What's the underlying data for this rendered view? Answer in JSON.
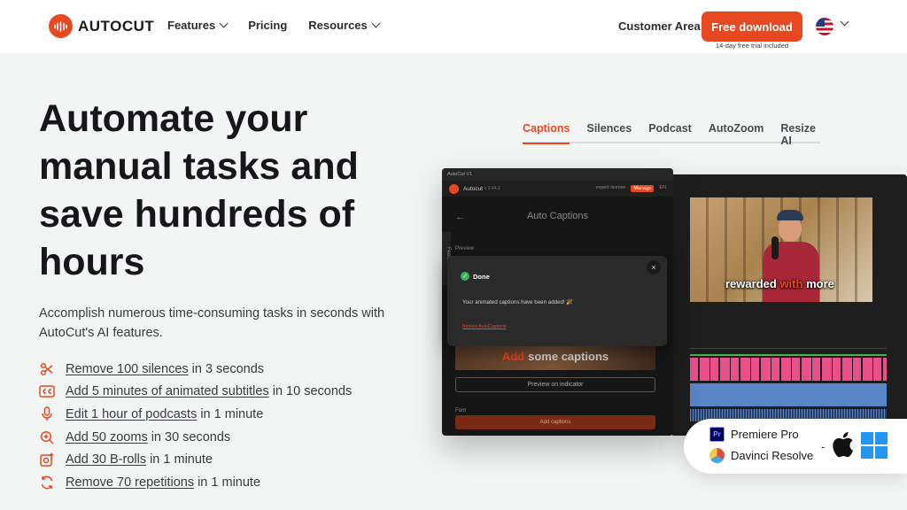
{
  "header": {
    "brand": "AUTOCUT",
    "nav": [
      {
        "label": "Features",
        "has_dropdown": true
      },
      {
        "label": "Pricing",
        "has_dropdown": false
      },
      {
        "label": "Resources",
        "has_dropdown": true
      }
    ],
    "customer_area": "Customer Area",
    "cta_label": "Free download",
    "cta_note": "14-day free trial included",
    "language_icon": "us-flag-icon"
  },
  "hero": {
    "title": "Automate your manual tasks and save hundreds of hours",
    "subtitle": "Accomplish numerous time-consuming tasks in seconds with AutoCut's AI features.",
    "features": [
      {
        "icon": "scissors-icon",
        "link": "Remove 100 silences",
        "rest": "in 3 seconds"
      },
      {
        "icon": "cc-icon",
        "link": "Add 5 minutes of animated subtitles",
        "rest": "in 10 seconds"
      },
      {
        "icon": "microphone-icon",
        "link": "Edit 1 hour of podcasts",
        "rest": "in 1 minute"
      },
      {
        "icon": "zoom-in-icon",
        "link": "Add 50 zooms",
        "rest": "in 30 seconds"
      },
      {
        "icon": "add-image-icon",
        "link": "Add 30 B-rolls",
        "rest": "in 1 minute"
      },
      {
        "icon": "repeat-icon",
        "link": "Remove 70 repetitions",
        "rest": "in 1 minute"
      }
    ]
  },
  "tabs": {
    "items": [
      "Captions",
      "Silences",
      "Podcast",
      "AutoZoom",
      "Resize AI"
    ],
    "active": "Captions"
  },
  "app_mock": {
    "window_title": "AutoCut V1",
    "app_name": "Autocut",
    "version": "v 2.44.3",
    "license": "expert license",
    "manage": "Manage",
    "lang": "EN",
    "panel_title": "Auto Captions",
    "preview_label": "Preview",
    "feedback": "Feedback",
    "thumb_caption_highlight": "Add",
    "thumb_caption_rest": "some captions",
    "preview_button": "Preview on indicator",
    "font_label": "Font",
    "add_button": "Add captions",
    "dialog": {
      "title": "Done",
      "message": "Your animated captions have been added! 🎉",
      "link": "Review AutoCaptions"
    },
    "video_caption": {
      "before": "rewarded",
      "highlight": "with",
      "after": "more"
    }
  },
  "compatibility": {
    "apps": [
      "Premiere Pro",
      "Davinci Resolve"
    ],
    "separator": "-",
    "os_icons": [
      "apple-icon",
      "windows-icon"
    ]
  },
  "colors": {
    "accent": "#e8481f",
    "background": "#f3f5f4",
    "text": "#1b1b1f"
  }
}
